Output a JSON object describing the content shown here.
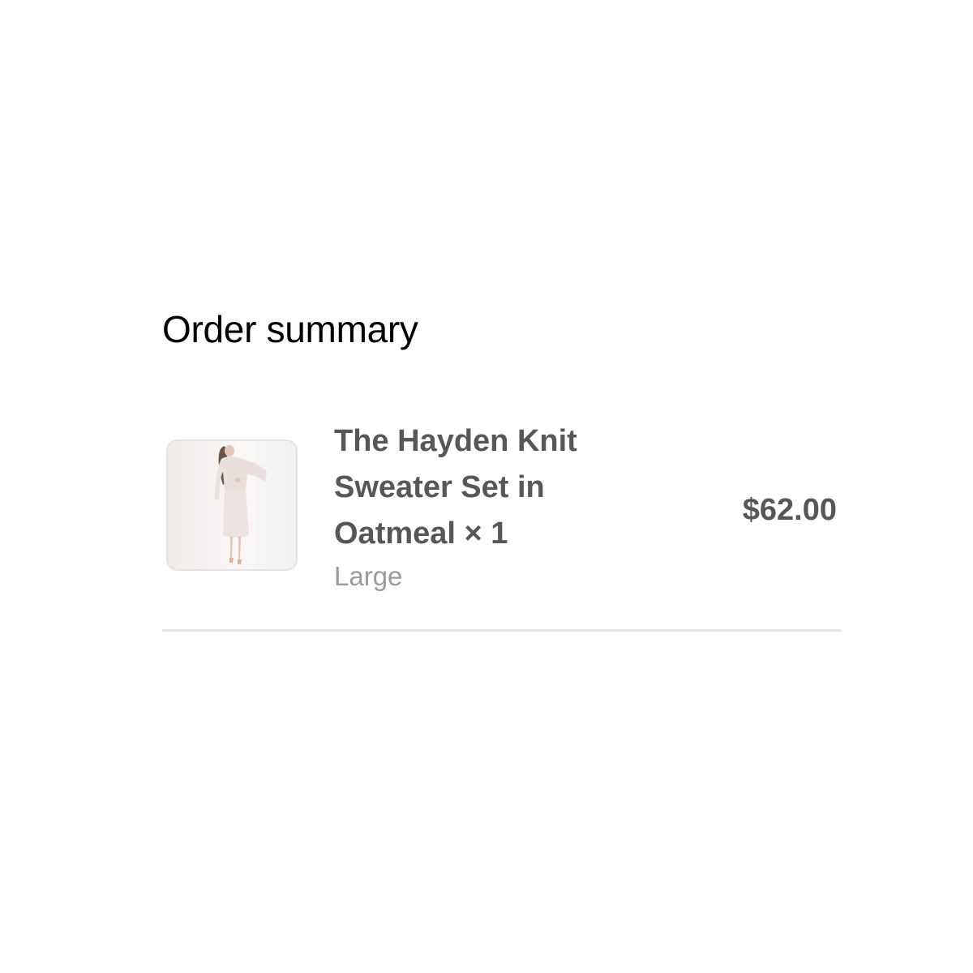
{
  "order_summary": {
    "title": "Order summary",
    "items": [
      {
        "name": "The Hayden Knit Sweater Set in Oatmeal",
        "quantity_label": "× 1",
        "name_with_quantity": "The Hayden Knit Sweater Set in Oatmeal × 1",
        "variant": "Large",
        "price": "$62.00",
        "thumbnail_icon": "product-photo-icon"
      }
    ]
  },
  "colors": {
    "title_text": "#000000",
    "item_text": "#575757",
    "variant_text": "#9b9b9b",
    "divider": "#e6e6e6"
  }
}
